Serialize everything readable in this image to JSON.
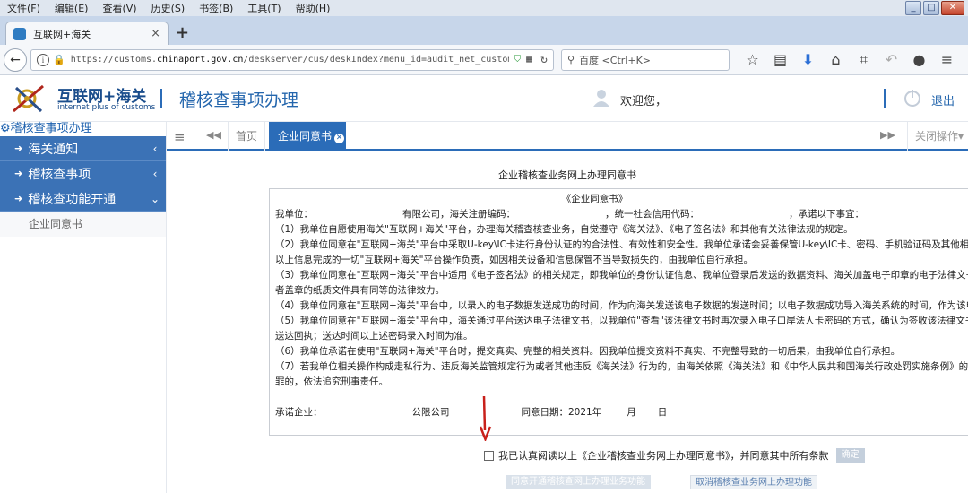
{
  "browser": {
    "menu": [
      "文件(F)",
      "编辑(E)",
      "查看(V)",
      "历史(S)",
      "书签(B)",
      "工具(T)",
      "帮助(H)"
    ],
    "window_controls": [
      "_",
      "□",
      "✕"
    ],
    "tab_title": "互联网+海关",
    "tab_close": "×",
    "new_tab": "+",
    "url_prefix": "https://customs.",
    "url_domain": "chinaport.gov.cn",
    "url_path": "/deskserver/cus/deskIndex?menu_id=audit_net_custom",
    "search_placeholder": "百度 <Ctrl+K>"
  },
  "header": {
    "logo_title": "互联网+海关",
    "logo_subtitle": "internet plus of customs",
    "page_title": "稽核查事项办理",
    "welcome": "欢迎您，",
    "logout": "退出"
  },
  "sidebar": {
    "top_label": "稽核查事项办理",
    "items": [
      {
        "label": "海关通知",
        "chevron": "‹"
      },
      {
        "label": "稽核查事项",
        "chevron": "‹"
      },
      {
        "label": "稽核查功能开通",
        "chevron": "⌄"
      }
    ],
    "sub_items": [
      "企业同意书"
    ]
  },
  "app_tabs": {
    "home": "首页",
    "active": "企业同意书",
    "close_ops": "关闭操作▾"
  },
  "document": {
    "page_heading": "企业稽核查业务网上办理同意书",
    "box_heading": "《企业同意书》",
    "intro_1": "我单位：",
    "intro_2": "有限公司，海关注册编码：",
    "intro_3": "，统一社会信用代码：",
    "intro_4": "，承诺以下事宜：",
    "lines": [
      "（1）我单位自愿使用海关\"互联网+海关\"平台，办理海关稽查核查业务，自觉遵守《海关法》、《电子签名法》和其他有关法律法规的规定。",
      "（2）我单位同意在\"互联网+海关\"平台中采取U-key\\IC卡进行身份认证的的合法性、有效性和安全性。我单位承诺会妥善保管U-key\\IC卡、密码、手机验证码及其他相关设备",
      "以上信息完成的一切\"互联网+海关\"平台操作负责，如因相关设备和信息保管不当导致损失的，由我单位自行承担。",
      "（3）我单位同意在\"互联网+海关\"平台中适用《电子签名法》的相关规定，即我单位的身份认证信息、我单位登录后发送的数据资料、海关加盖电子印章的电子法律文书等电子",
      "者盖章的纸质文件具有同等的法律效力。",
      "（4）我单位同意在\"互联网+海关\"平台中，以录入的电子数据发送成功的时间，作为向海关发送该电子数据的发送时间；以电子数据成功导入海关系统的时间，作为该电子数据",
      "（5）我单位同意在\"互联网+海关\"平台中，海关通过平台送达电子法律文书，以我单位\"查看\"该法律文书时再次录入电子口岸法人卡密码的方式，确认为签收该法律文书，并由",
      "送达回执；送达时间以上述密码录入时间为准。",
      "（6）我单位承诺在使用\"互联网+海关\"平台时，提交真实、完整的相关资料。因我单位提交资料不真实、不完整导致的一切后果，由我单位自行承担。",
      "（7）若我单位相关操作构成走私行为、违反海关监管规定行为或者其他违反《海关法》行为的，由海关依照《海关法》和《中华人民共和国海关行政处罚实施条例》的有关规定",
      "罪的，依法追究刑事责任。"
    ],
    "signer_label": "承诺企业：",
    "signer_value": "公限公司",
    "date_label": "同意日期：2021年",
    "date_month": "月",
    "date_day": "日"
  },
  "agreement": {
    "checkbox_label": "我已认真阅读以上《企业稽核查业务网上办理同意书》，并同意其中所有条款",
    "confirm": "确定"
  },
  "actions": {
    "open_label": "同意开通稽核查网上办理业务功能",
    "cancel_label": "取消稽核查业务网上办理功能"
  },
  "colors": {
    "brand_blue": "#2b6cb8",
    "sidebar_blue": "#3b72b6",
    "arrow_red": "#c8201a"
  }
}
